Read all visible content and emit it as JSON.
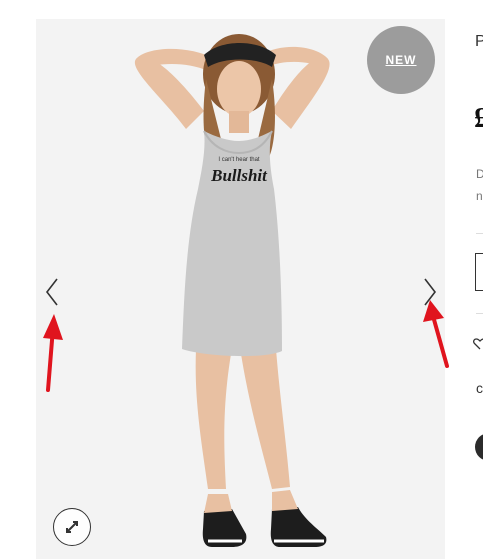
{
  "product": {
    "badge": "NEW",
    "brand_initial": "P",
    "price_symbol": "£",
    "description_line1": "D",
    "description_line2": "n",
    "option_initial": "c",
    "shirt_print_small": "I can't hear that",
    "shirt_print_main": "Bullshit"
  },
  "gallery": {
    "prev_icon": "chevron-left-icon",
    "next_icon": "chevron-right-icon",
    "zoom_icon": "expand-icon"
  },
  "colors": {
    "badge_bg": "#9c9c9c",
    "annotation_arrow": "#e0141e",
    "dress": "#c9c9c9"
  }
}
